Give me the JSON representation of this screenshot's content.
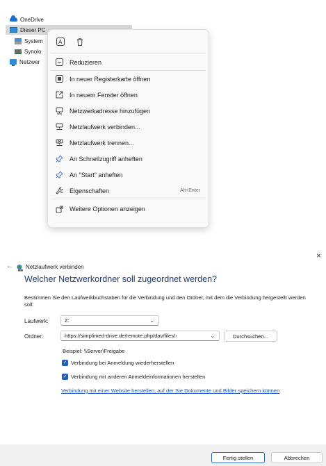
{
  "tree": {
    "items": [
      {
        "label": "OneDrive",
        "icon": "cloud-icon"
      },
      {
        "label": "Dieser PC",
        "icon": "computer-icon"
      },
      {
        "label": "System",
        "icon": "system-drive-icon"
      },
      {
        "label": "Synolo",
        "icon": "network-drive-icon"
      },
      {
        "label": "Netzwer",
        "icon": "network-icon"
      }
    ]
  },
  "context_menu": {
    "top_icons": [
      "copilot-icon",
      "trash-icon"
    ],
    "collapse": "Reduzieren",
    "items": [
      {
        "label": "In neuer Registerkarte öffnen",
        "icon": "new-tab-icon"
      },
      {
        "label": "In neuem Fenster öffnen",
        "icon": "new-window-icon"
      },
      {
        "label": "Netzwerkadresse hinzufügen",
        "icon": "network-location-icon"
      },
      {
        "label": "Netzlaufwerk verbinden...",
        "icon": "map-drive-icon"
      },
      {
        "label": "Netzlaufwerk trennen...",
        "icon": "disconnect-drive-icon"
      },
      {
        "label": "An Schnellzugriff anheften",
        "icon": "pin-icon"
      },
      {
        "label": "An \"Start\" anheften",
        "icon": "pin-icon"
      },
      {
        "label": "Eigenschaften",
        "icon": "properties-icon",
        "accel": "Alt+Enter"
      }
    ],
    "more": "Weitere Optionen anzeigen"
  },
  "wizard": {
    "close": "×",
    "back": "←",
    "title": "Netzlaufwerk verbinden",
    "heading": "Welcher Netzwerkordner soll zugeordnet werden?",
    "description": "Bestimmen Sie den Laufwerkbuchstaben für die Verbindung und den Ordner, mit dem die Verbindung hergestellt werden soll:",
    "drive_label": "Laufwerk:",
    "drive_value": "Z:",
    "folder_label": "Ordner:",
    "folder_value": "https://simplimed-drive.de/remote.php/dav/files/›",
    "browse": "Durchsuchen...",
    "example": "Beispiel: \\\\Server\\Freigabe",
    "reconnect": "Verbindung bei Anmeldung wiederherstellen",
    "reconnect_checked": true,
    "other_credentials": "Verbindung mit anderen Anmeldeinformationen herstellen",
    "other_credentials_checked": true,
    "website_link": "Verbindung mit einer Website herstellen, auf der Sie Dokumente und Bilder speichern können",
    "finish": "Fertig stellen",
    "cancel": "Abbrechen"
  },
  "colors": {
    "heading": "#1f3c7a",
    "link": "#1a57c2",
    "checkbox": "#1e5fbf"
  }
}
